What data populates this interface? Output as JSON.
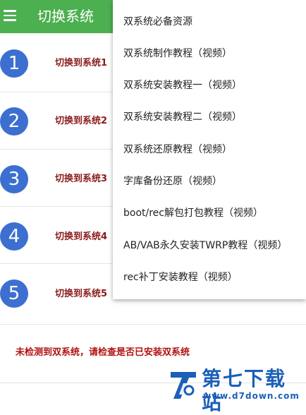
{
  "app": {
    "title": "切换系统"
  },
  "rows": [
    {
      "number": "1",
      "label": "切换到系统1"
    },
    {
      "number": "2",
      "label": "切换到系统2"
    },
    {
      "number": "3",
      "label": "切换到系统3"
    },
    {
      "number": "4",
      "label": "切换到系统4"
    },
    {
      "number": "5",
      "label": "切换到系统5"
    }
  ],
  "warning": "未检测到双系统，请检查是否已安装双系统",
  "menu": {
    "items": [
      "双系统必备资源",
      "双系统制作教程（视频）",
      "双系统安装教程一（视频）",
      "双系统安装教程二（视频）",
      "双系统还原教程（视频）",
      "字库备份还原（视频）",
      "boot/rec解包打包教程（视频）",
      "AB/VAB永久安装TWRP教程（视频）",
      "rec补丁安装教程（视频）"
    ]
  },
  "watermark": {
    "name": "第七下载站",
    "url": "www.d7down.com"
  },
  "colors": {
    "appbar": "#4caf50",
    "circle": "#3c6fd0",
    "label": "#8b1a1a",
    "warning": "#b21212",
    "watermark": "#1c5fb8"
  },
  "icons": {
    "menu": "hamburger-icon"
  }
}
